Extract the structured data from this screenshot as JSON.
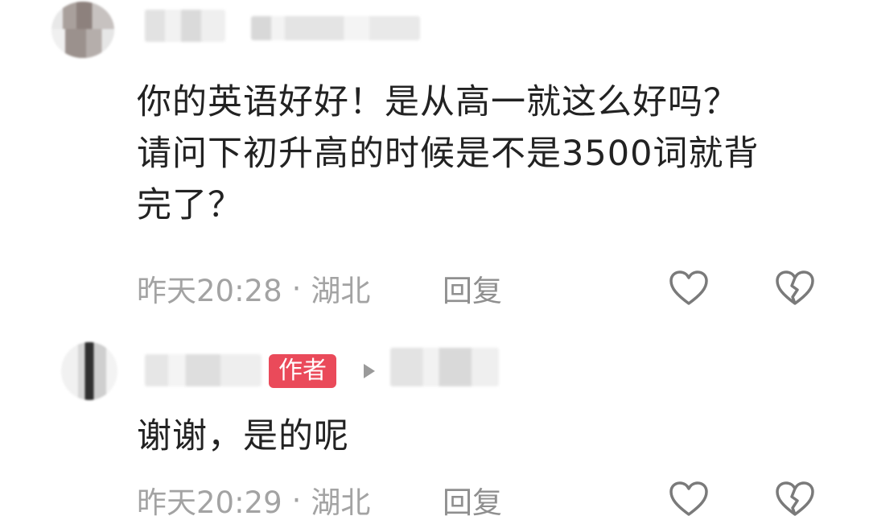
{
  "comments": [
    {
      "text": "你的英语好好！是从高一就这么好吗？\n请问下初升高的时候是不是3500词就背\n完了？",
      "time": "昨天20:28",
      "separator": "·",
      "location": "湖北",
      "reply_label": "回复",
      "like_icon": "heart-outline-icon",
      "dislike_icon": "broken-heart-icon"
    },
    {
      "author_badge": "作者",
      "reply_arrow_icon": "triangle-right-icon",
      "text": "谢谢，是的呢",
      "time": "昨天20:29",
      "separator": "·",
      "location": "湖北",
      "reply_label": "回复",
      "like_icon": "heart-outline-icon",
      "dislike_icon": "broken-heart-icon"
    }
  ],
  "colors": {
    "text": "#222222",
    "meta": "#a3a3a3",
    "icon": "#7a7a7a",
    "badge": "#ea4a5a"
  }
}
